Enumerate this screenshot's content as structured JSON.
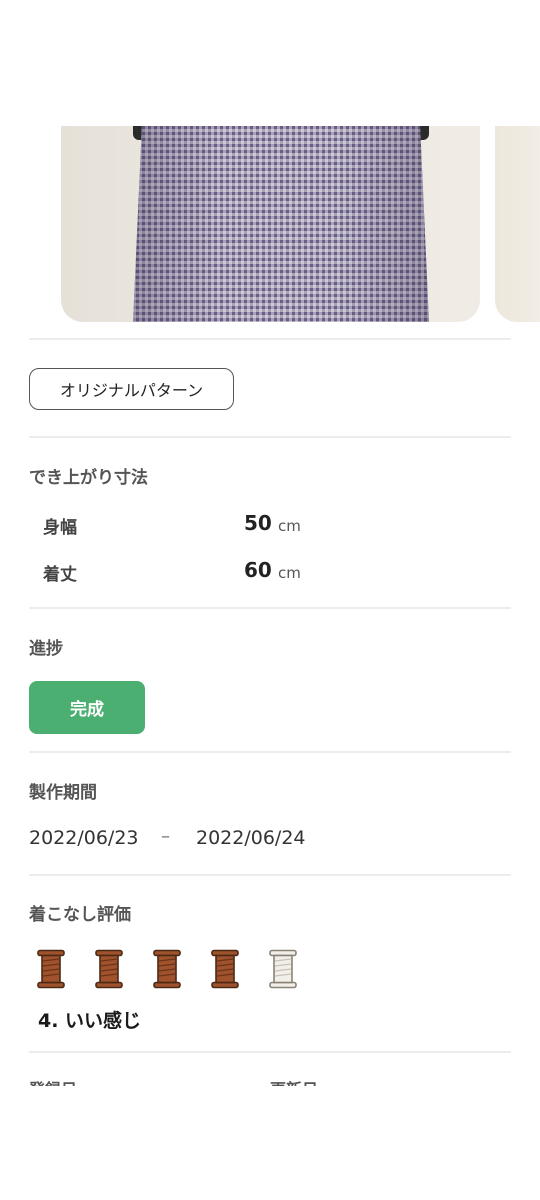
{
  "pattern": {
    "label": "オリジナルパターン"
  },
  "dimensions": {
    "title": "でき上がり寸法",
    "items": [
      {
        "label": "身幅",
        "value": "50",
        "unit": "cm"
      },
      {
        "label": "着丈",
        "value": "60",
        "unit": "cm"
      }
    ]
  },
  "progress": {
    "title": "進捗",
    "status": "完成",
    "color": "#4caf72"
  },
  "period": {
    "title": "製作期間",
    "start": "2022/06/23",
    "separator": "–",
    "end": "2022/06/24"
  },
  "rating": {
    "title": "着こなし評価",
    "value": 4,
    "max": 5,
    "label": "4. いい感じ",
    "icon": "thread-spool-icon",
    "filled_color": "#a0522d",
    "empty_color": "#f2efe8"
  },
  "meta": {
    "registered_label": "登録日",
    "updated_label": "更新日"
  }
}
